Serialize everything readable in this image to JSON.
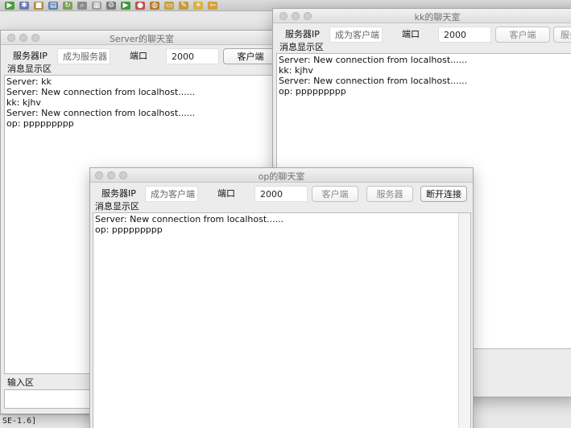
{
  "ide": {
    "status_text": "SE-1.6]"
  },
  "server_window": {
    "title": "Server的聊天室",
    "ip_label": "服务器IP",
    "ip_field": "成为服务器",
    "port_label": "端口",
    "port_value": "2000",
    "client_button": "客户端",
    "message_group": "消息显示区",
    "messages": [
      "Server: kk",
      "Server: New connection from localhost......",
      "kk: kjhv",
      "Server: New connection from localhost......",
      "op: ppppppppp"
    ],
    "input_group": "输入区"
  },
  "kk_window": {
    "title": "kk的聊天室",
    "ip_label": "服务器IP",
    "ip_field": "成为客户端",
    "port_label": "端口",
    "port_value": "2000",
    "client_button": "客户端",
    "server_button": "服务",
    "message_group": "消息显示区",
    "messages": [
      "Server: New connection from localhost......",
      "kk: kjhv",
      "Server: New connection from localhost......",
      "op: ppppppppp"
    ]
  },
  "op_window": {
    "title": "op的聊天室",
    "ip_label": "服务器IP",
    "ip_field": "成为客户端",
    "port_label": "端口",
    "port_value": "2000",
    "client_button": "客户端",
    "server_button": "服务器",
    "disconnect_button": "断开连接",
    "message_group": "消息显示区",
    "messages": [
      "Server: New connection from localhost......",
      "op: ppppppppp"
    ]
  }
}
